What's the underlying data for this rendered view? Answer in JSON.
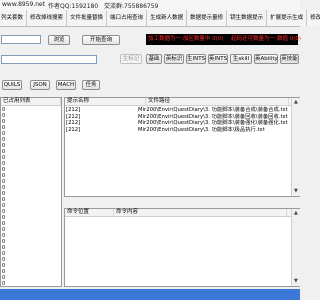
{
  "titlebar": {
    "site": "www.8959.net",
    "author": "作者QQ:1592180",
    "group": "交流群:755886759"
  },
  "tabs": [
    "列关套数",
    "修改掉线搜索",
    "文件批量替换",
    "端口占用查询",
    "生成新人数据",
    "数据提示量修",
    "钥生数据提示",
    "扩展提示生成",
    "修改"
  ],
  "toolbar": {
    "path_value": "",
    "browse_label": "浏览",
    "query_label": "开始查询"
  },
  "red_status": [
    "加工数据为一:加区数量中 0(0)",
    "起码还可数量为一:数值 0(0)"
  ],
  "toolbar2": {
    "shape_input_value": "",
    "disabled_label": "生标记",
    "buttons": [
      "基础",
      "英标识",
      "生INTS",
      "英INTS",
      "生skill",
      "英Ability",
      "英技能"
    ]
  },
  "filters": [
    "QUILS",
    "JSON",
    "MACH",
    "任务"
  ],
  "left_panel": {
    "header": "已占用列表",
    "line_numbers": [
      "0",
      "0",
      "0",
      "0",
      "0",
      "0",
      "0",
      "0",
      "0",
      "0",
      "0",
      "0",
      "0",
      "0",
      "0",
      "0",
      "0",
      "0",
      "0",
      "0",
      "0",
      "0",
      "0",
      "0",
      "0",
      "0",
      "0",
      "0",
      "0",
      "0",
      "0",
      "0"
    ]
  },
  "results": {
    "columns": [
      "提示名称",
      "文件路径"
    ],
    "rows": [
      {
        "name": "[212]",
        "path": "Mir200\\Envir\\QuestDiary\\3. 功能脚本\\装备合成\\装备合成.txt"
      },
      {
        "name": "[212]",
        "path": "Mir200\\Envir\\QuestDiary\\3. 功能脚本\\装备回收\\装备回收.txt"
      },
      {
        "name": "[212]",
        "path": "Mir200\\Envir\\QuestDiary\\3. 功能脚本\\装备强化\\装备强化.txt"
      },
      {
        "name": "[212]",
        "path": "Mir200\\Envir\\QuestDiary\\3. 功能脚本\\极品执行.txt"
      }
    ]
  },
  "command_panel": {
    "columns": [
      "命令位置",
      "命令内容"
    ]
  },
  "colors": {
    "status_bar": "#3c78d8",
    "red_text": "#ff2a2a"
  }
}
